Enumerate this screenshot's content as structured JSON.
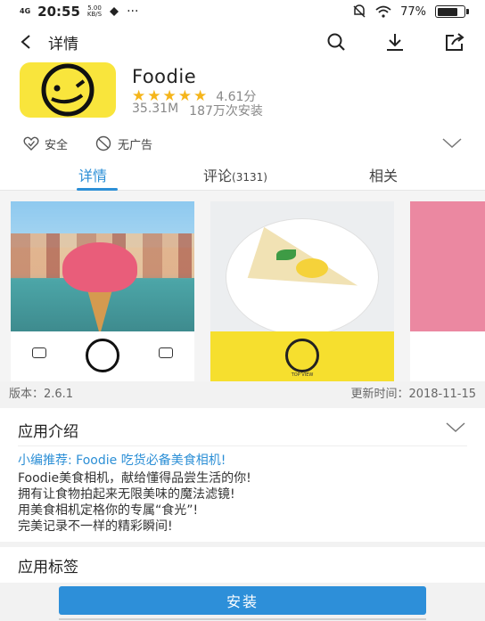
{
  "status_bar": {
    "network": "4G",
    "time": "20:55",
    "speed_value": "5.00",
    "speed_unit": "KB/S",
    "dots": "···",
    "battery": "77%",
    "battery_level": 0.77
  },
  "header": {
    "title": "详情",
    "icons": [
      "back-arrow-icon",
      "search-icon",
      "download-icon",
      "share-icon"
    ]
  },
  "app": {
    "name": "Foodie",
    "rating_stars": 5,
    "score": "4.61分",
    "size": "35.31M",
    "installs": "187万次安装",
    "icon_bg": "#f9e53c"
  },
  "badges": {
    "safe": "安全",
    "no_ads": "无广告"
  },
  "tabs": {
    "details": "详情",
    "comments": "评论",
    "comments_count": "(3131)",
    "related": "相关",
    "active_color": "#2c8fd6"
  },
  "screenshots": {
    "shot2_caption": "TOP VIEW"
  },
  "version": {
    "version_text": "版本：2.6.1",
    "updated_text": "更新时间：2018-11-15"
  },
  "intro": {
    "heading": "应用介绍",
    "editor_pick": "小编推荐: Foodie 吃货必备美食相机!",
    "lines": [
      "Foodie美食相机，献给懂得品尝生活的你!",
      "拥有让食物拍起来无限美味的魔法滤镜!",
      "用美食相机定格你的专属“食光”!",
      "完美记录不一样的精彩瞬间!"
    ]
  },
  "tags": {
    "heading": "应用标签"
  },
  "install": {
    "label": "安装",
    "color": "#2d8fd9"
  }
}
